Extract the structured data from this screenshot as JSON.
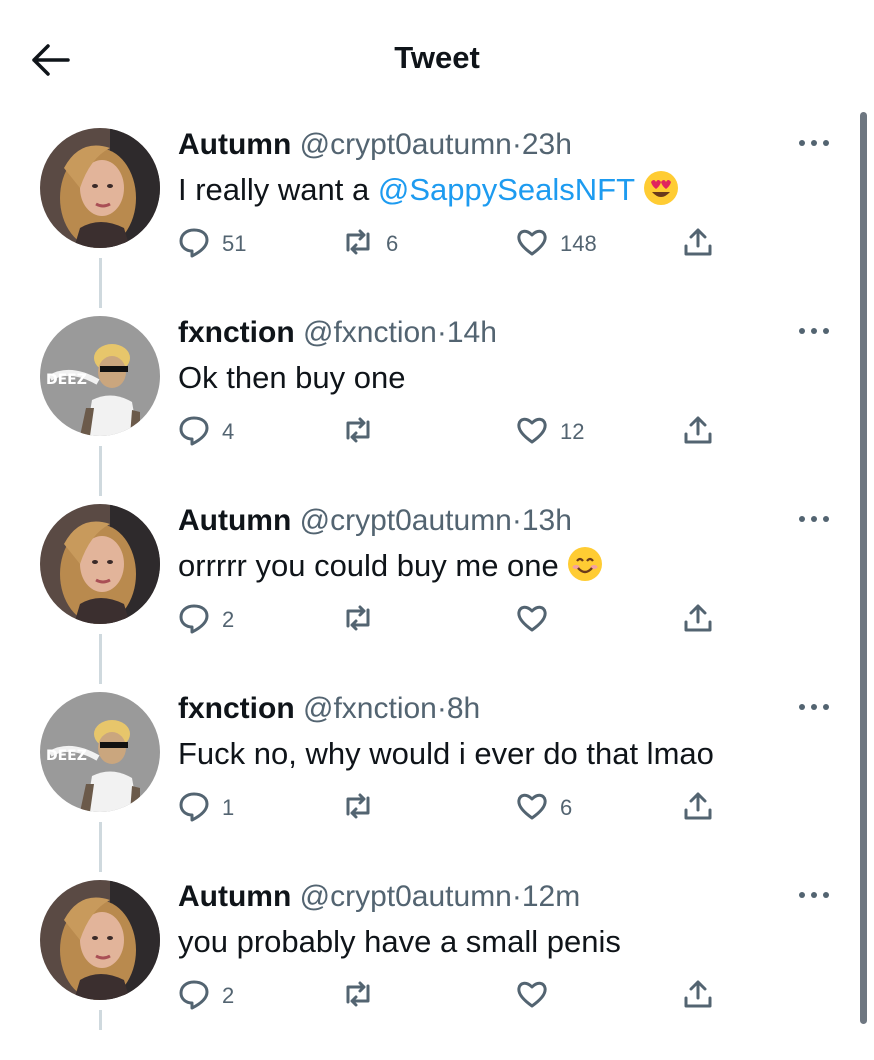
{
  "header": {
    "title": "Tweet"
  },
  "tweets": [
    {
      "name": "Autumn",
      "handle": "@crypt0autumn",
      "dot": "·",
      "time": "23h",
      "text": "I really want a ",
      "mention": "@SappySealsNFT",
      "emoji": "heart-eyes-emoji",
      "replies": "51",
      "retweets": "6",
      "likes": "148"
    },
    {
      "name": "fxnction",
      "handle": "@fxnction",
      "dot": "·",
      "time": "14h",
      "text": "Ok then buy one",
      "mention": "",
      "emoji": "",
      "replies": "4",
      "retweets": "",
      "likes": "12"
    },
    {
      "name": "Autumn",
      "handle": "@crypt0autumn",
      "dot": "·",
      "time": "13h",
      "text": "orrrrr you could buy me one",
      "mention": "",
      "emoji": "smiling-face-emoji",
      "replies": "2",
      "retweets": "",
      "likes": ""
    },
    {
      "name": "fxnction",
      "handle": "@fxnction",
      "dot": "·",
      "time": "8h",
      "text": "Fuck no, why would i ever do that lmao",
      "mention": "",
      "emoji": "",
      "replies": "1",
      "retweets": "",
      "likes": "6"
    },
    {
      "name": "Autumn",
      "handle": "@crypt0autumn",
      "dot": "·",
      "time": "12m",
      "text": "you probably have a small penis",
      "mention": "",
      "emoji": "",
      "replies": "2",
      "retweets": "",
      "likes": ""
    }
  ],
  "icons": {
    "back": "back-arrow-icon",
    "more": "more-icon",
    "reply": "reply-icon",
    "retweet": "retweet-icon",
    "like": "like-icon",
    "share": "share-icon"
  },
  "colors": {
    "accent": "#1d9bf0",
    "text": "#0f1419",
    "muted": "#536471",
    "thread": "#cfd9de"
  }
}
